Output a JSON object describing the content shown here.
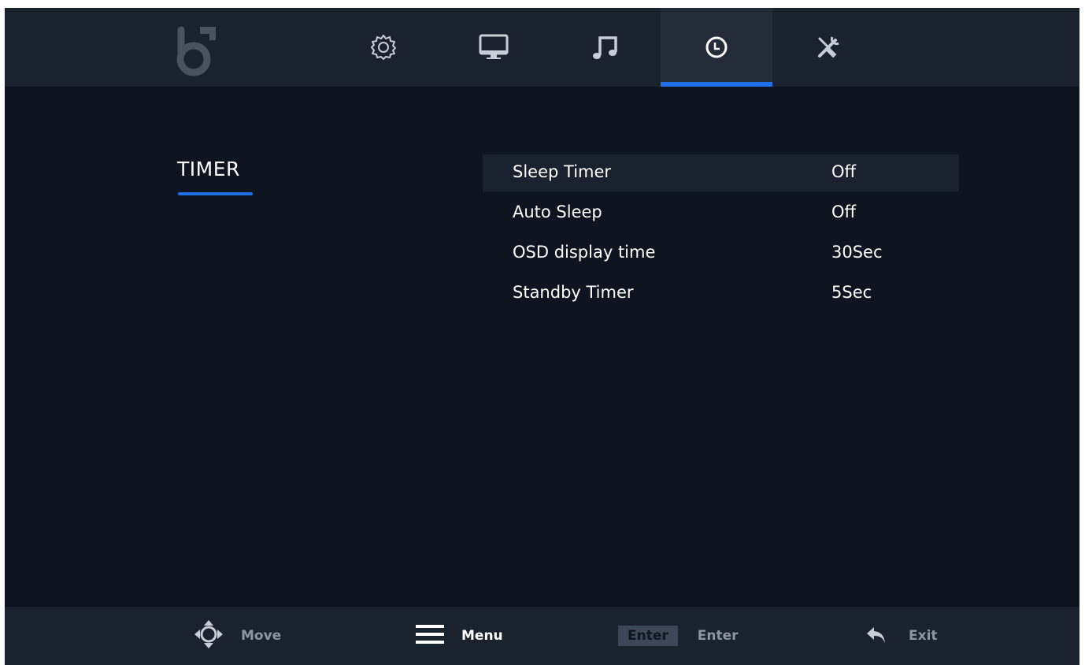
{
  "brand": {
    "logo_icon": "brand-logo-icon"
  },
  "nav": {
    "tabs": [
      {
        "icon": "gear-icon",
        "active": false
      },
      {
        "icon": "monitor-icon",
        "active": false
      },
      {
        "icon": "music-note-icon",
        "active": false
      },
      {
        "icon": "clock-icon",
        "active": true
      },
      {
        "icon": "tools-icon",
        "active": false
      }
    ],
    "accent_color": "#1f6fe6"
  },
  "section": {
    "title": "TIMER"
  },
  "settings": {
    "items": [
      {
        "label": "Sleep Timer",
        "value": "Off",
        "selected": true
      },
      {
        "label": "Auto Sleep",
        "value": "Off",
        "selected": false
      },
      {
        "label": "OSD display time",
        "value": "30Sec",
        "selected": false
      },
      {
        "label": "Standby Timer",
        "value": "5Sec",
        "selected": false
      }
    ]
  },
  "hints": {
    "move": {
      "icon": "dpad-icon",
      "label": "Move"
    },
    "menu": {
      "icon": "hamburger-menu-icon",
      "label": "Menu"
    },
    "enter": {
      "key": "Enter",
      "label": "Enter"
    },
    "exit": {
      "icon": "back-arrow-icon",
      "label": "Exit"
    }
  }
}
